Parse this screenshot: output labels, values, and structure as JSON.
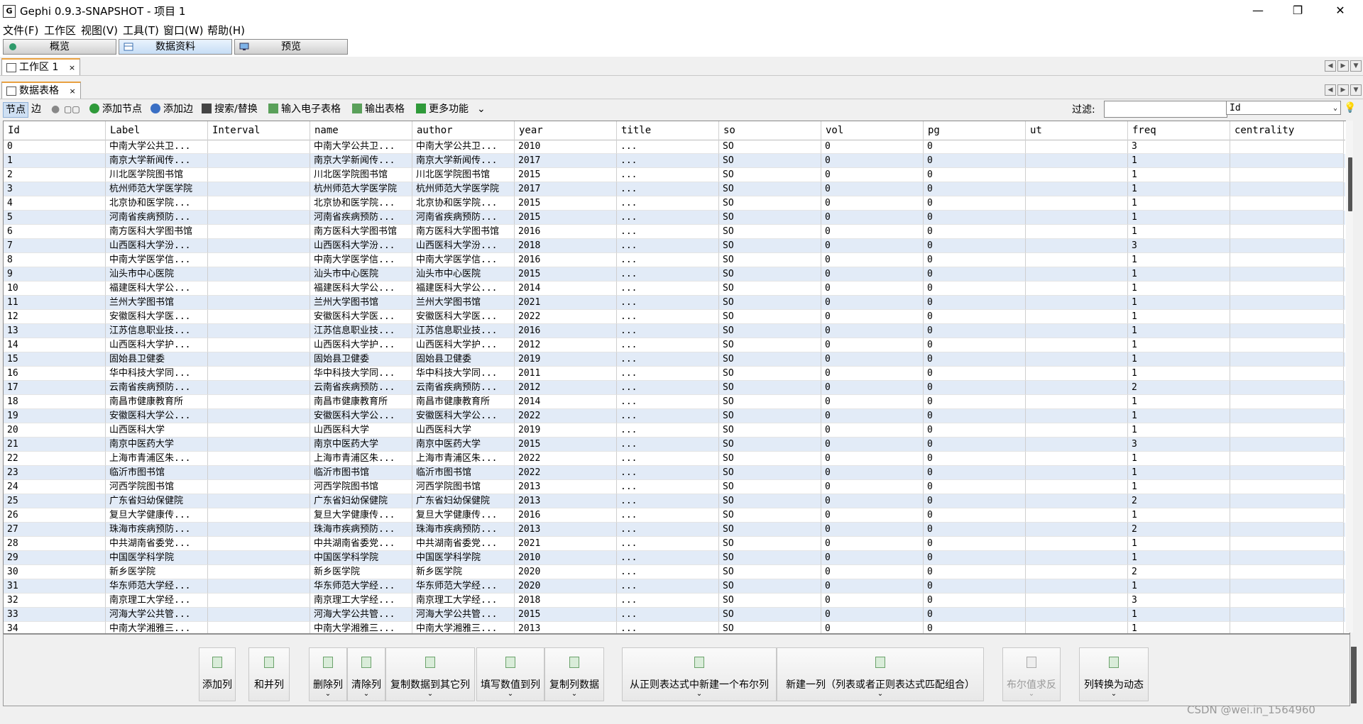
{
  "window": {
    "title": "Gephi 0.9.3-SNAPSHOT - 项目 1",
    "min": "—",
    "max": "❐",
    "close": "✕"
  },
  "menu": [
    "文件(F)",
    "工作区",
    "视图(V)",
    "工具(T)",
    "窗口(W)",
    "帮助(H)"
  ],
  "modes": [
    "概览",
    "数据资料",
    "预览"
  ],
  "active_mode": 1,
  "workspace_tab": {
    "label": "工作区 1",
    "close": "×"
  },
  "datatable_tab": {
    "label": "数据表格",
    "close": "×"
  },
  "toolbar": {
    "nodes": "节点",
    "edges": "边",
    "add_node": "添加节点",
    "add_edge": "添加边",
    "search_replace": "搜索/替换",
    "import": "输入电子表格",
    "export": "输出表格",
    "more": "更多功能",
    "more_arrow": "⌄"
  },
  "filter": {
    "label": "过滤:",
    "value": "",
    "column": "Id",
    "arrow": "⌄"
  },
  "columns": [
    "Id",
    "Label",
    "Interval",
    "name",
    "author",
    "year",
    "title",
    "so",
    "vol",
    "pg",
    "ut",
    "freq",
    "centrality"
  ],
  "rows": [
    [
      "0",
      "中南大学公共卫...",
      "",
      "中南大学公共卫...",
      "中南大学公共卫...",
      "2010",
      "...",
      "SO",
      "0",
      "0",
      "",
      "3",
      ""
    ],
    [
      "1",
      "南京大学新闻传...",
      "",
      "南京大学新闻传...",
      "南京大学新闻传...",
      "2017",
      "...",
      "SO",
      "0",
      "0",
      "",
      "1",
      ""
    ],
    [
      "2",
      "川北医学院图书馆",
      "",
      "川北医学院图书馆",
      "川北医学院图书馆",
      "2015",
      "...",
      "SO",
      "0",
      "0",
      "",
      "1",
      ""
    ],
    [
      "3",
      "杭州师范大学医学院",
      "",
      "杭州师范大学医学院",
      "杭州师范大学医学院",
      "2017",
      "...",
      "SO",
      "0",
      "0",
      "",
      "1",
      ""
    ],
    [
      "4",
      "北京协和医学院...",
      "",
      "北京协和医学院...",
      "北京协和医学院...",
      "2015",
      "...",
      "SO",
      "0",
      "0",
      "",
      "1",
      ""
    ],
    [
      "5",
      "河南省疾病预防...",
      "",
      "河南省疾病预防...",
      "河南省疾病预防...",
      "2015",
      "...",
      "SO",
      "0",
      "0",
      "",
      "1",
      ""
    ],
    [
      "6",
      "南方医科大学图书馆",
      "",
      "南方医科大学图书馆",
      "南方医科大学图书馆",
      "2016",
      "...",
      "SO",
      "0",
      "0",
      "",
      "1",
      ""
    ],
    [
      "7",
      "山西医科大学汾...",
      "",
      "山西医科大学汾...",
      "山西医科大学汾...",
      "2018",
      "...",
      "SO",
      "0",
      "0",
      "",
      "3",
      ""
    ],
    [
      "8",
      "中南大学医学信...",
      "",
      "中南大学医学信...",
      "中南大学医学信...",
      "2016",
      "...",
      "SO",
      "0",
      "0",
      "",
      "1",
      ""
    ],
    [
      "9",
      "汕头市中心医院",
      "",
      "汕头市中心医院",
      "汕头市中心医院",
      "2015",
      "...",
      "SO",
      "0",
      "0",
      "",
      "1",
      ""
    ],
    [
      "10",
      "福建医科大学公...",
      "",
      "福建医科大学公...",
      "福建医科大学公...",
      "2014",
      "...",
      "SO",
      "0",
      "0",
      "",
      "1",
      ""
    ],
    [
      "11",
      "兰州大学图书馆",
      "",
      "兰州大学图书馆",
      "兰州大学图书馆",
      "2021",
      "...",
      "SO",
      "0",
      "0",
      "",
      "1",
      ""
    ],
    [
      "12",
      "安徽医科大学医...",
      "",
      "安徽医科大学医...",
      "安徽医科大学医...",
      "2022",
      "...",
      "SO",
      "0",
      "0",
      "",
      "1",
      ""
    ],
    [
      "13",
      "江苏信息职业技...",
      "",
      "江苏信息职业技...",
      "江苏信息职业技...",
      "2016",
      "...",
      "SO",
      "0",
      "0",
      "",
      "1",
      ""
    ],
    [
      "14",
      "山西医科大学护...",
      "",
      "山西医科大学护...",
      "山西医科大学护...",
      "2012",
      "...",
      "SO",
      "0",
      "0",
      "",
      "1",
      ""
    ],
    [
      "15",
      "固始县卫健委",
      "",
      "固始县卫健委",
      "固始县卫健委",
      "2019",
      "...",
      "SO",
      "0",
      "0",
      "",
      "1",
      ""
    ],
    [
      "16",
      "华中科技大学同...",
      "",
      "华中科技大学同...",
      "华中科技大学同...",
      "2011",
      "...",
      "SO",
      "0",
      "0",
      "",
      "1",
      ""
    ],
    [
      "17",
      "云南省疾病预防...",
      "",
      "云南省疾病预防...",
      "云南省疾病预防...",
      "2012",
      "...",
      "SO",
      "0",
      "0",
      "",
      "2",
      ""
    ],
    [
      "18",
      "南昌市健康教育所",
      "",
      "南昌市健康教育所",
      "南昌市健康教育所",
      "2014",
      "...",
      "SO",
      "0",
      "0",
      "",
      "1",
      ""
    ],
    [
      "19",
      "安徽医科大学公...",
      "",
      "安徽医科大学公...",
      "安徽医科大学公...",
      "2022",
      "...",
      "SO",
      "0",
      "0",
      "",
      "1",
      ""
    ],
    [
      "20",
      "山西医科大学",
      "",
      "山西医科大学",
      "山西医科大学",
      "2019",
      "...",
      "SO",
      "0",
      "0",
      "",
      "1",
      ""
    ],
    [
      "21",
      "南京中医药大学",
      "",
      "南京中医药大学",
      "南京中医药大学",
      "2015",
      "...",
      "SO",
      "0",
      "0",
      "",
      "3",
      ""
    ],
    [
      "22",
      "上海市青浦区朱...",
      "",
      "上海市青浦区朱...",
      "上海市青浦区朱...",
      "2022",
      "...",
      "SO",
      "0",
      "0",
      "",
      "1",
      ""
    ],
    [
      "23",
      "临沂市图书馆",
      "",
      "临沂市图书馆",
      "临沂市图书馆",
      "2022",
      "...",
      "SO",
      "0",
      "0",
      "",
      "1",
      ""
    ],
    [
      "24",
      "河西学院图书馆",
      "",
      "河西学院图书馆",
      "河西学院图书馆",
      "2013",
      "...",
      "SO",
      "0",
      "0",
      "",
      "1",
      ""
    ],
    [
      "25",
      "广东省妇幼保健院",
      "",
      "广东省妇幼保健院",
      "广东省妇幼保健院",
      "2013",
      "...",
      "SO",
      "0",
      "0",
      "",
      "2",
      ""
    ],
    [
      "26",
      "复旦大学健康传...",
      "",
      "复旦大学健康传...",
      "复旦大学健康传...",
      "2016",
      "...",
      "SO",
      "0",
      "0",
      "",
      "1",
      ""
    ],
    [
      "27",
      "珠海市疾病预防...",
      "",
      "珠海市疾病预防...",
      "珠海市疾病预防...",
      "2013",
      "...",
      "SO",
      "0",
      "0",
      "",
      "2",
      ""
    ],
    [
      "28",
      "中共湖南省委党...",
      "",
      "中共湖南省委党...",
      "中共湖南省委党...",
      "2021",
      "...",
      "SO",
      "0",
      "0",
      "",
      "1",
      ""
    ],
    [
      "29",
      "中国医学科学院",
      "",
      "中国医学科学院",
      "中国医学科学院",
      "2010",
      "...",
      "SO",
      "0",
      "0",
      "",
      "1",
      ""
    ],
    [
      "30",
      "新乡医学院",
      "",
      "新乡医学院",
      "新乡医学院",
      "2020",
      "...",
      "SO",
      "0",
      "0",
      "",
      "2",
      ""
    ],
    [
      "31",
      "华东师范大学经...",
      "",
      "华东师范大学经...",
      "华东师范大学经...",
      "2020",
      "...",
      "SO",
      "0",
      "0",
      "",
      "1",
      ""
    ],
    [
      "32",
      "南京理工大学经...",
      "",
      "南京理工大学经...",
      "南京理工大学经...",
      "2018",
      "...",
      "SO",
      "0",
      "0",
      "",
      "3",
      ""
    ],
    [
      "33",
      "河海大学公共管...",
      "",
      "河海大学公共管...",
      "河海大学公共管...",
      "2015",
      "...",
      "SO",
      "0",
      "0",
      "",
      "1",
      ""
    ],
    [
      "34",
      "中南大学湘雅三...",
      "",
      "中南大学湘雅三...",
      "中南大学湘雅三...",
      "2013",
      "...",
      "SO",
      "0",
      "0",
      "",
      "1",
      ""
    ]
  ],
  "actions": [
    {
      "label": "添加列",
      "chevron": ""
    },
    {
      "label": "和并列",
      "chevron": ""
    },
    {
      "label": "删除列",
      "chevron": "⌄"
    },
    {
      "label": "清除列",
      "chevron": "⌄"
    },
    {
      "label": "复制数据到其它列",
      "chevron": "⌄"
    },
    {
      "label": "填写数值到列",
      "chevron": "⌄"
    },
    {
      "label": "复制列数据",
      "chevron": "⌄"
    },
    {
      "label": "从正则表达式中新建一个布尔列",
      "chevron": "⌄"
    },
    {
      "label": "新建一列（列表或者正则表达式匹配组合）",
      "chevron": "⌄"
    },
    {
      "label": "布尔值求反",
      "chevron": "⌄"
    },
    {
      "label": "列转换为动态",
      "chevron": "⌄"
    }
  ],
  "watermark": "CSDN @wei.in_1564960",
  "colors": {
    "row_alt": "#e2ebf7",
    "active_tab": "#c6ddf5",
    "accent_orange": "#e8a040"
  }
}
